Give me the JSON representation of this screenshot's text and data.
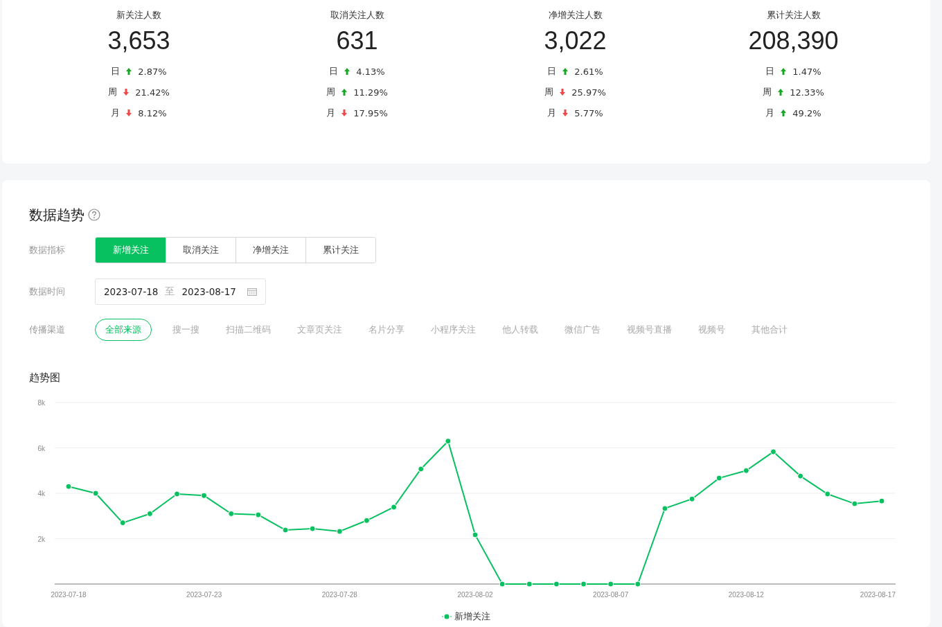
{
  "stats": [
    {
      "label": "新关注人数",
      "value": "3,653",
      "changes": [
        {
          "period": "日",
          "up": true,
          "value": "2.87%"
        },
        {
          "period": "周",
          "up": false,
          "value": "21.42%"
        },
        {
          "period": "月",
          "up": false,
          "value": "8.12%"
        }
      ]
    },
    {
      "label": "取消关注人数",
      "value": "631",
      "changes": [
        {
          "period": "日",
          "up": true,
          "value": "4.13%"
        },
        {
          "period": "周",
          "up": true,
          "value": "11.29%"
        },
        {
          "period": "月",
          "up": false,
          "value": "17.95%"
        }
      ]
    },
    {
      "label": "净增关注人数",
      "value": "3,022",
      "changes": [
        {
          "period": "日",
          "up": true,
          "value": "2.61%"
        },
        {
          "period": "周",
          "up": false,
          "value": "25.97%"
        },
        {
          "period": "月",
          "up": false,
          "value": "5.77%"
        }
      ]
    },
    {
      "label": "累计关注人数",
      "value": "208,390",
      "changes": [
        {
          "period": "日",
          "up": true,
          "value": "1.47%"
        },
        {
          "period": "周",
          "up": true,
          "value": "12.33%"
        },
        {
          "period": "月",
          "up": true,
          "value": "49.2%"
        }
      ]
    }
  ],
  "trend": {
    "title": "数据趋势",
    "metric": {
      "label": "数据指标",
      "options": [
        {
          "label": "新增关注",
          "selected": true
        },
        {
          "label": "取消关注",
          "selected": false
        },
        {
          "label": "净增关注",
          "selected": false
        },
        {
          "label": "累计关注",
          "selected": false
        }
      ]
    },
    "time": {
      "label": "数据时间",
      "start": "2023-07-18",
      "separator": "至",
      "end": "2023-08-17"
    },
    "channel": {
      "label": "传播渠道",
      "options": [
        {
          "label": "全部来源",
          "selected": true
        },
        {
          "label": "搜一搜",
          "selected": false
        },
        {
          "label": "扫描二维码",
          "selected": false
        },
        {
          "label": "文章页关注",
          "selected": false
        },
        {
          "label": "名片分享",
          "selected": false
        },
        {
          "label": "小程序关注",
          "selected": false
        },
        {
          "label": "他人转载",
          "selected": false
        },
        {
          "label": "微信广告",
          "selected": false
        },
        {
          "label": "视频号直播",
          "selected": false
        },
        {
          "label": "视频号",
          "selected": false
        },
        {
          "label": "其他合计",
          "selected": false
        }
      ]
    },
    "chart_title": "趋势图",
    "chart_data": {
      "type": "line",
      "grid": true,
      "categories": [
        "2023-07-18",
        null,
        null,
        null,
        null,
        "2023-07-23",
        null,
        null,
        null,
        null,
        "2023-07-28",
        null,
        null,
        null,
        null,
        "2023-08-02",
        null,
        null,
        null,
        null,
        "2023-08-07",
        null,
        null,
        null,
        null,
        "2023-08-12",
        null,
        null,
        null,
        null,
        "2023-08-17"
      ],
      "ylim": [
        0,
        8000
      ],
      "yticks": [
        {
          "value": 2000,
          "label": "2k"
        },
        {
          "value": 4000,
          "label": "4k"
        },
        {
          "value": 6000,
          "label": "6k"
        },
        {
          "value": 8000,
          "label": "8k"
        }
      ],
      "series": [
        {
          "name": "新增关注",
          "color": "#07c160",
          "marker": "circle",
          "values": [
            4300,
            4000,
            2700,
            3100,
            3970,
            3900,
            3100,
            3050,
            2380,
            2440,
            2320,
            2800,
            3390,
            5070,
            6300,
            2170,
            0,
            0,
            0,
            0,
            0,
            0,
            3330,
            3750,
            4670,
            5000,
            5830,
            4760,
            3970,
            3540,
            3660
          ]
        }
      ]
    }
  }
}
